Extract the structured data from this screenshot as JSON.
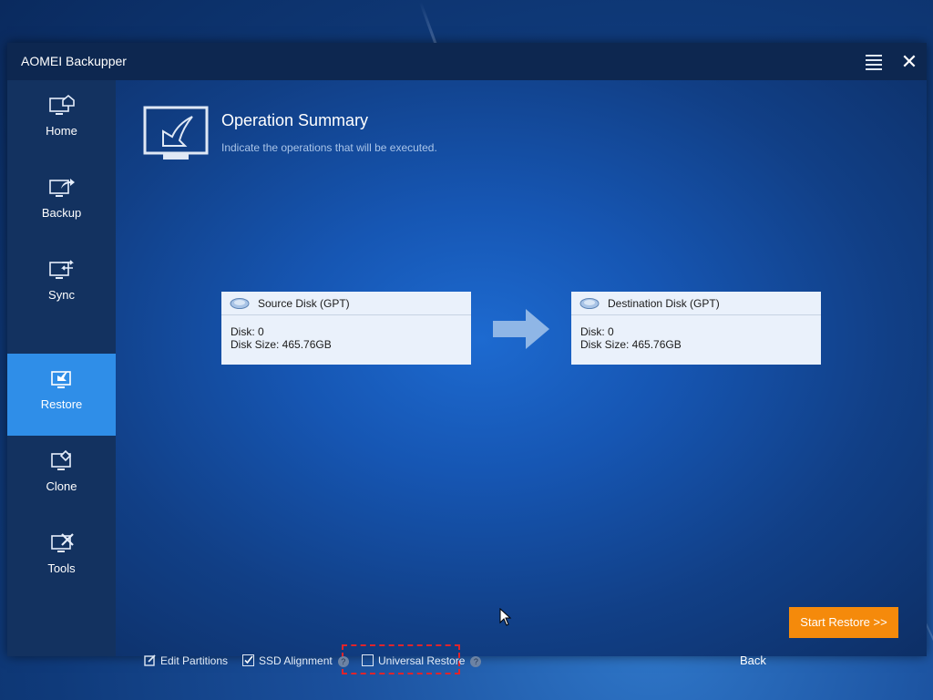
{
  "window": {
    "title": "AOMEI Backupper",
    "menu_icon": "hamburger-menu-icon",
    "close_icon": "close-icon"
  },
  "sidebar": {
    "items": [
      {
        "label": "Home",
        "icon": "home-monitor-icon",
        "active": false
      },
      {
        "label": "Backup",
        "icon": "backup-monitor-icon",
        "active": false
      },
      {
        "label": "Sync",
        "icon": "sync-monitor-icon",
        "active": false
      },
      {
        "label": "Restore",
        "icon": "restore-monitor-icon",
        "active": true
      },
      {
        "label": "Clone",
        "icon": "clone-monitor-icon",
        "active": false
      },
      {
        "label": "Tools",
        "icon": "tools-monitor-icon",
        "active": false
      }
    ]
  },
  "summary": {
    "title": "Operation Summary",
    "subtitle": "Indicate the operations that will be executed."
  },
  "source": {
    "title": "Source Disk (GPT)",
    "disk": "Disk: 0",
    "size": "Disk Size: 465.76GB"
  },
  "destination": {
    "title": "Destination Disk (GPT)",
    "disk": "Disk: 0",
    "size": "Disk Size: 465.76GB"
  },
  "options": {
    "edit_partitions": {
      "label": "Edit Partitions",
      "checked": false
    },
    "ssd_alignment": {
      "label": "SSD Alignment",
      "checked": true
    },
    "universal_restore": {
      "label": "Universal Restore",
      "checked": false
    },
    "help_glyph": "?"
  },
  "actions": {
    "back": "Back",
    "start": "Start Restore >>"
  },
  "colors": {
    "accent": "#2f8ee8",
    "start_button": "#f58a0b",
    "highlight": "#e0242b"
  }
}
